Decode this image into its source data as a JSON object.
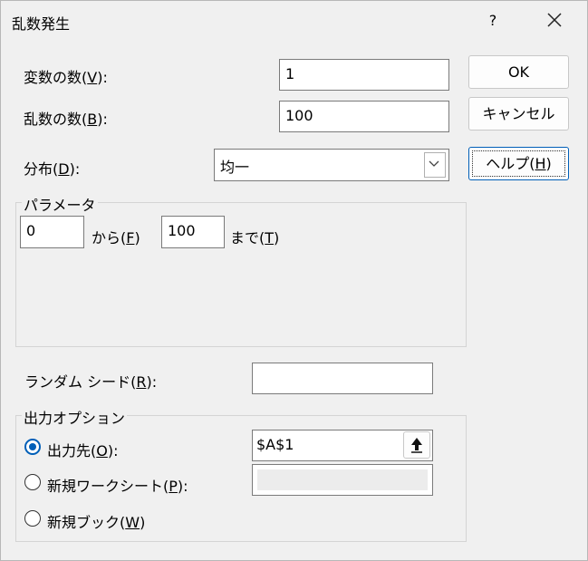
{
  "dialog": {
    "title": "乱数発生",
    "help_glyph": "?"
  },
  "fields": {
    "num_variables": {
      "label": "変数の数(",
      "key": "V",
      "suffix": "):",
      "value": "1"
    },
    "num_randoms": {
      "label": "乱数の数(",
      "key": "B",
      "suffix": "):",
      "value": "100"
    },
    "distribution": {
      "label": "分布(",
      "key": "D",
      "suffix": "):",
      "value": "均一"
    }
  },
  "buttons": {
    "ok": "OK",
    "cancel": "キャンセル",
    "help": {
      "label": "ヘルプ(",
      "key": "H",
      "suffix": ")"
    }
  },
  "parameters": {
    "group_title": "パラメータ",
    "from_value": "0",
    "from_label": {
      "label": "から(",
      "key": "F",
      "suffix": ")"
    },
    "to_value": "100",
    "to_label": {
      "label": "まで(",
      "key": "T",
      "suffix": ")"
    }
  },
  "random_seed": {
    "label": "ランダム シード(",
    "key": "R",
    "suffix": "):",
    "value": ""
  },
  "output_options": {
    "group_title": "出力オプション",
    "output_range": {
      "label": "出力先(",
      "key": "O",
      "suffix": "):",
      "value": "$A$1",
      "selected": true
    },
    "new_sheet": {
      "label": "新規ワークシート(",
      "key": "P",
      "suffix": "):",
      "selected": false
    },
    "new_book": {
      "label": "新規ブック(",
      "key": "W",
      "suffix": ")",
      "selected": false
    }
  }
}
